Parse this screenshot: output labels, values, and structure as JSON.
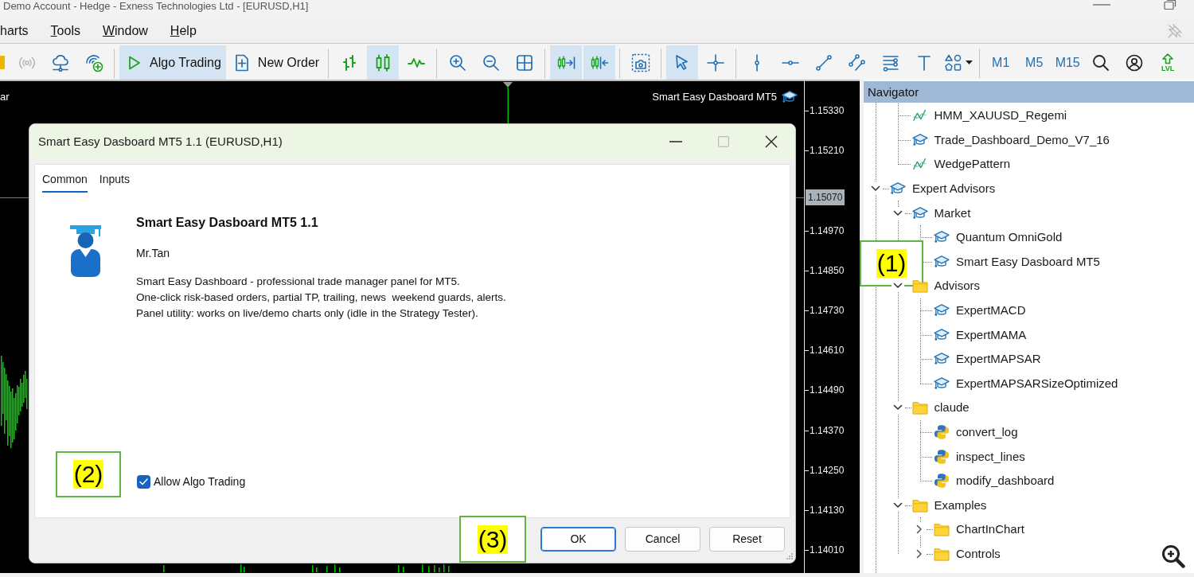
{
  "window": {
    "title": "Demo Account - Hedge - Exness Technologies Ltd - [EURUSD,H1]"
  },
  "menu": [
    {
      "label": "harts",
      "mnemonic": false
    },
    {
      "label": "Tools",
      "mnemonic": true
    },
    {
      "label": "Window",
      "mnemonic": true
    },
    {
      "label": "Help",
      "mnemonic": true
    }
  ],
  "toolbar": {
    "groups": [
      [
        {
          "kind": "icon",
          "pressed": false,
          "disabled": false
        },
        {
          "kind": "icon",
          "pressed": false,
          "disabled": true
        },
        {
          "kind": "icon",
          "pressed": false,
          "disabled": false
        },
        {
          "kind": "icon",
          "pressed": false,
          "disabled": false
        }
      ],
      [
        {
          "kind": "icon-label",
          "label": "Algo Trading",
          "pressed": true,
          "disabled": false
        },
        {
          "kind": "icon-label",
          "label": "New Order",
          "pressed": false,
          "disabled": false
        }
      ],
      [
        {
          "kind": "icon",
          "pressed": false,
          "disabled": false
        },
        {
          "kind": "icon",
          "pressed": true,
          "disabled": false
        },
        {
          "kind": "icon",
          "pressed": false,
          "disabled": false
        }
      ],
      [
        {
          "kind": "icon",
          "pressed": false,
          "disabled": false
        },
        {
          "kind": "icon",
          "pressed": false,
          "disabled": false
        },
        {
          "kind": "icon",
          "pressed": false,
          "disabled": false
        }
      ],
      [
        {
          "kind": "icon",
          "pressed": true,
          "disabled": false
        },
        {
          "kind": "icon",
          "pressed": true,
          "disabled": false
        }
      ],
      [
        {
          "kind": "icon",
          "pressed": false,
          "disabled": false
        }
      ],
      [
        {
          "kind": "icon",
          "pressed": true,
          "disabled": false
        },
        {
          "kind": "icon",
          "pressed": false,
          "disabled": false
        }
      ],
      [
        {
          "kind": "icon",
          "pressed": false,
          "disabled": false
        },
        {
          "kind": "icon",
          "pressed": false,
          "disabled": false
        },
        {
          "kind": "icon",
          "pressed": false,
          "disabled": false
        },
        {
          "kind": "icon",
          "pressed": false,
          "disabled": false
        },
        {
          "kind": "icon",
          "pressed": false,
          "disabled": false
        },
        {
          "kind": "icon",
          "pressed": false,
          "disabled": false
        },
        {
          "kind": "icon-menu",
          "pressed": false,
          "disabled": false
        }
      ],
      [
        {
          "kind": "text",
          "label": "M1",
          "pressed": false,
          "disabled": false
        },
        {
          "kind": "text",
          "label": "M5",
          "pressed": false,
          "disabled": false
        },
        {
          "kind": "text",
          "label": "M15",
          "pressed": false,
          "disabled": false
        },
        {
          "kind": "icon",
          "pressed": false,
          "disabled": false
        },
        {
          "kind": "icon",
          "pressed": false,
          "disabled": false
        },
        {
          "kind": "icon-caption",
          "label": "LVL",
          "pressed": false,
          "disabled": false
        }
      ]
    ]
  },
  "chart": {
    "caption": "ar",
    "expert_label": "Smart Easy Dasboard MT5",
    "price_axis": {
      "labels": [
        "1.15330",
        "1.15210",
        "1.14970",
        "1.14850",
        "1.14730",
        "1.14610",
        "1.14490",
        "1.14370",
        "1.14250",
        "1.14130",
        "1.14010"
      ],
      "current_price": "1.15070"
    }
  },
  "dialog": {
    "title": "Smart Easy Dasboard MT5 1.1 (EURUSD,H1)",
    "window_buttons": [
      {
        "kind": "minimize",
        "disabled": false
      },
      {
        "kind": "maximize",
        "disabled": true
      },
      {
        "kind": "close",
        "disabled": false
      }
    ],
    "tabs": [
      {
        "label": "Common",
        "selected": true
      },
      {
        "label": "Inputs",
        "selected": false
      }
    ],
    "program": {
      "name": "Smart Easy Dasboard MT5 1.1",
      "author": "Mr.Tan",
      "description": "Smart Easy Dashboard - professional trade manager panel for MT5.\nOne-click risk-based orders, partial TP, trailing, news  weekend guards, alerts.\nPanel utility: works on live/demo charts only (idle in the Strategy Tester)."
    },
    "options": [
      {
        "label": "Allow Algo Trading",
        "checked": true
      }
    ],
    "buttons": [
      {
        "label": "OK",
        "default": true
      },
      {
        "label": "Cancel",
        "default": false
      },
      {
        "label": "Reset",
        "default": false
      }
    ]
  },
  "navigator": {
    "title": "Navigator",
    "tree": [
      {
        "children": [
          {
            "kind": "indicator",
            "label": "HMM_XAUUSD_Regemi"
          },
          {
            "kind": "expert",
            "label": "Trade_Dashboard_Demo_V7_16"
          },
          {
            "kind": "indicator",
            "label": "WedgePattern"
          }
        ]
      },
      {
        "kind": "expert",
        "label": "Expert Advisors",
        "expanded": true,
        "children": [
          {
            "kind": "expert",
            "label": "Market",
            "expanded": true,
            "children": [
              {
                "kind": "expert",
                "label": "Quantum OmniGold"
              },
              {
                "kind": "expert",
                "label": "Smart Easy Dasboard MT5"
              }
            ]
          },
          {
            "kind": "folder",
            "label": "Advisors",
            "expanded": true,
            "children": [
              {
                "kind": "expert",
                "label": "ExpertMACD"
              },
              {
                "kind": "expert",
                "label": "ExpertMAMA"
              },
              {
                "kind": "expert",
                "label": "ExpertMAPSAR"
              },
              {
                "kind": "expert",
                "label": "ExpertMAPSARSizeOptimized"
              }
            ]
          },
          {
            "kind": "folder",
            "label": "claude",
            "expanded": true,
            "children": [
              {
                "kind": "script",
                "label": "convert_log"
              },
              {
                "kind": "script",
                "label": "inspect_lines"
              },
              {
                "kind": "script",
                "label": "modify_dashboard"
              }
            ]
          },
          {
            "kind": "folder",
            "label": "Examples",
            "expanded": true,
            "children": [
              {
                "kind": "folder",
                "label": "ChartInChart",
                "expanded": false
              },
              {
                "kind": "folder",
                "label": "Controls",
                "expanded": false
              }
            ]
          }
        ]
      }
    ]
  },
  "annotations": [
    {
      "label": "(1)"
    },
    {
      "label": "(2)"
    },
    {
      "label": "(3)"
    }
  ]
}
